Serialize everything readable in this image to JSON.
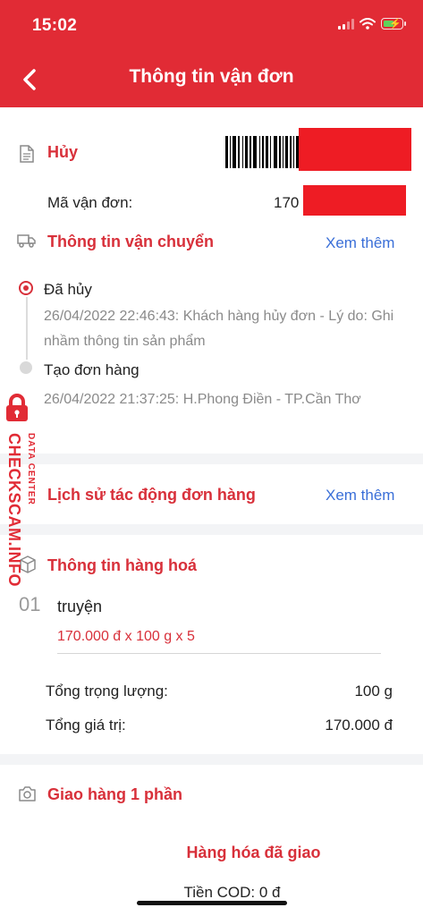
{
  "status_bar": {
    "time": "15:02"
  },
  "header": {
    "title": "Thông tin vận đơn"
  },
  "order": {
    "status_label": "Hủy",
    "code_label": "Mã vận đơn:",
    "code_value": "170"
  },
  "shipping": {
    "title": "Thông tin vận chuyển",
    "more_link": "Xem thêm",
    "events": [
      {
        "status": "Đã hủy",
        "detail": "26/04/2022 22:46:43: Khách hàng hủy đơn - Lý do:  Ghi nhầm thông tin sản phẩm"
      },
      {
        "status": "Tạo đơn hàng",
        "detail": "26/04/2022 21:37:25: H.Phong Điền - TP.Cần Thơ"
      }
    ]
  },
  "history": {
    "title": "Lịch sử tác động đơn hàng",
    "more_link": "Xem thêm"
  },
  "goods": {
    "title": "Thông tin hàng hoá",
    "items": [
      {
        "index": "01",
        "name": "truyện",
        "price_line": "170.000 đ x 100 g x 5"
      }
    ],
    "total_weight_label": "Tổng trọng lượng:",
    "total_weight_value": "100 g",
    "total_value_label": "Tổng giá trị:",
    "total_value_value": "170.000 đ"
  },
  "partial": {
    "title": "Giao hàng 1 phần",
    "delivered_label": "Hàng hóa đã giao",
    "cod_label": "Tiền COD: 0 đ"
  },
  "watermark": {
    "line1": "DATA CENTER",
    "line2": "CHECKSCAM.INFO"
  },
  "colors": {
    "brand": "#e12b35",
    "link": "#3a6fd8",
    "redaction": "#ee1c24"
  }
}
